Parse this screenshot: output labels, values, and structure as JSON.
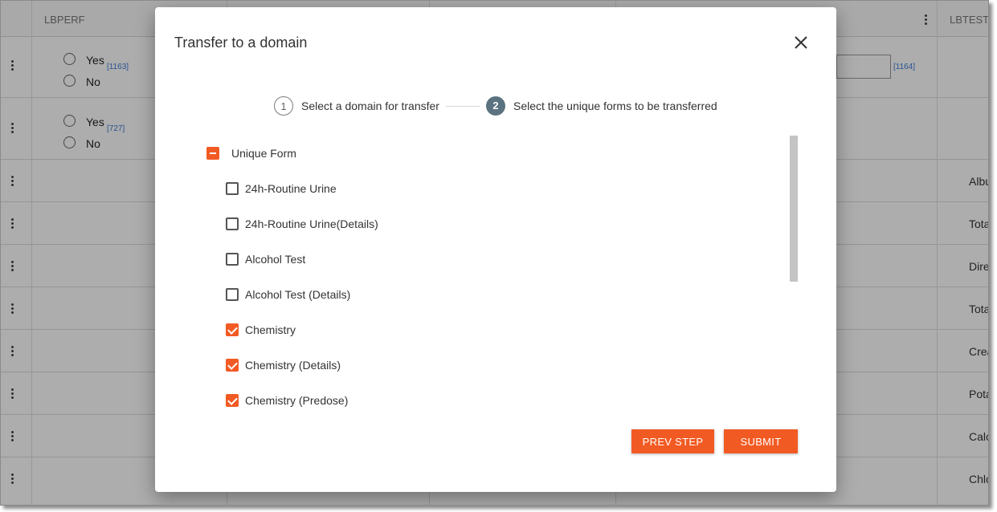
{
  "background": {
    "headers": {
      "col1": "LBPERF",
      "col2": "LBTEST"
    },
    "rows": [
      {
        "options": [
          "Yes",
          "No"
        ],
        "ref": "[1163]"
      },
      {
        "options": [
          "Yes",
          "No"
        ],
        "ref": "[727]"
      }
    ],
    "input_ref": "[1164]",
    "right_texts": [
      "Albu",
      "Tota",
      "Dire",
      "Tota",
      "Crea",
      "Pota",
      "Calc",
      "Chlo"
    ]
  },
  "modal": {
    "title": "Transfer to a domain",
    "close_icon": "close-icon",
    "steps": [
      {
        "number": "1",
        "label": "Select a domain for transfer"
      },
      {
        "number": "2",
        "label": "Select the unique forms to be transferred"
      }
    ],
    "parent": {
      "label": "Unique Form",
      "state": "indeterminate"
    },
    "forms": [
      {
        "label": "24h-Routine Urine",
        "checked": false
      },
      {
        "label": "24h-Routine Urine(Details)",
        "checked": false
      },
      {
        "label": "Alcohol Test",
        "checked": false
      },
      {
        "label": "Alcohol Test (Details)",
        "checked": false
      },
      {
        "label": "Chemistry",
        "checked": true
      },
      {
        "label": "Chemistry (Details)",
        "checked": true
      },
      {
        "label": "Chemistry (Predose)",
        "checked": true
      }
    ],
    "buttons": {
      "prev": "PREV STEP",
      "submit": "SUBMIT"
    }
  },
  "colors": {
    "accent": "#f25a23",
    "step_active": "#5b7280"
  }
}
